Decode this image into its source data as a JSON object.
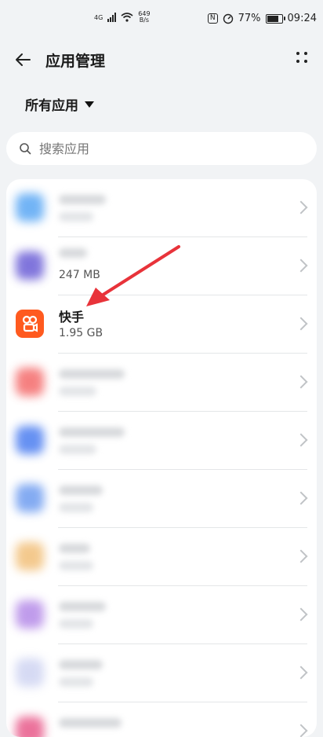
{
  "status": {
    "signal_label": "4G",
    "speed_value": "649",
    "speed_unit": "B/s",
    "nfc_label": "N",
    "battery": "77%",
    "time": "09:24"
  },
  "header": {
    "title": "应用管理"
  },
  "filter": {
    "label": "所有应用"
  },
  "search": {
    "placeholder": "搜索应用"
  },
  "apps": [
    {
      "name": "",
      "size": "",
      "icon_color": "#5aa7f4"
    },
    {
      "name": "",
      "size": "247 MB",
      "icon_color": "#6b5ed6"
    },
    {
      "name": "快手",
      "size": "1.95 GB",
      "icon_color": "#ff5a1f"
    },
    {
      "name": "",
      "size": "",
      "icon_color": "#f46b6b"
    },
    {
      "name": "",
      "size": "",
      "icon_color": "#4c7ef0"
    },
    {
      "name": "",
      "size": "",
      "icon_color": "#6f9df0"
    },
    {
      "name": "",
      "size": "",
      "icon_color": "#f2c07a"
    },
    {
      "name": "",
      "size": "",
      "icon_color": "#b58be8"
    },
    {
      "name": "",
      "size": "",
      "icon_color": "#cfd4f2"
    },
    {
      "name": "",
      "size": "",
      "icon_color": "#e85a8a"
    }
  ],
  "colors": {
    "accent_arrow": "#e8333a",
    "kuaishou_orange": "#ff5a1f"
  }
}
